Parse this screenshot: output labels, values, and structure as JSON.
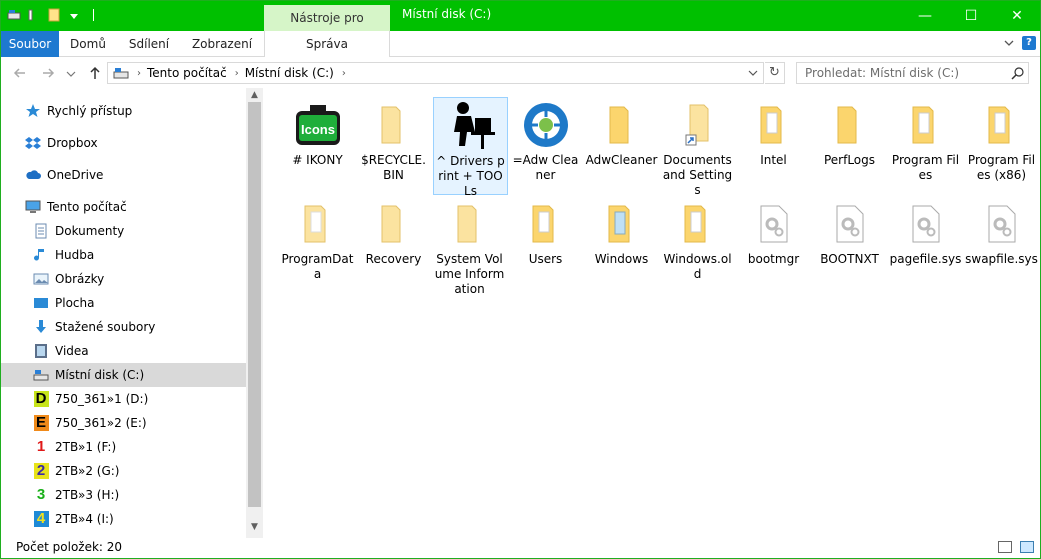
{
  "titlebar": {
    "context_tab": "Nástroje pro jednotky",
    "title": "Místní disk (C:)",
    "minimize": "—",
    "maximize": "☐",
    "close": "✕"
  },
  "ribbon": {
    "tabs": [
      "Soubor",
      "Domů",
      "Sdílení",
      "Zobrazení",
      "Správa"
    ],
    "help": "?"
  },
  "address": {
    "crumbs": [
      "Tento počítač",
      "Místní disk (C:)"
    ],
    "search_placeholder": "Prohledat: Místní disk (C:)"
  },
  "sidebar": {
    "items": [
      {
        "label": "Rychlý přístup",
        "icon": "star-icon"
      },
      {
        "label": "Dropbox",
        "icon": "dropbox-icon"
      },
      {
        "label": "OneDrive",
        "icon": "cloud-icon"
      },
      {
        "label": "Tento počítač",
        "icon": "computer-icon"
      },
      {
        "label": "Dokumenty",
        "icon": "document-icon"
      },
      {
        "label": "Hudba",
        "icon": "music-icon"
      },
      {
        "label": "Obrázky",
        "icon": "pictures-icon"
      },
      {
        "label": "Plocha",
        "icon": "desktop-icon"
      },
      {
        "label": "Stažené soubory",
        "icon": "download-icon"
      },
      {
        "label": "Videa",
        "icon": "video-icon"
      },
      {
        "label": "Místní disk (C:)",
        "icon": "drive-icon"
      },
      {
        "label": "750_361»1 (D:)",
        "icon": "drive-d-icon",
        "letter": "D"
      },
      {
        "label": "750_361»2 (E:)",
        "icon": "drive-e-icon",
        "letter": "E"
      },
      {
        "label": "2TB»1 (F:)",
        "icon": "drive-f-icon",
        "letter": "1"
      },
      {
        "label": "2TB»2 (G:)",
        "icon": "drive-g-icon",
        "letter": "2"
      },
      {
        "label": "2TB»3 (H:)",
        "icon": "drive-h-icon",
        "letter": "3"
      },
      {
        "label": "2TB»4 (I:)",
        "icon": "drive-i-icon",
        "letter": "4"
      }
    ]
  },
  "content": {
    "items": [
      {
        "label": "# IKONY",
        "type": "icons-folder",
        "icon_text": "Icons"
      },
      {
        "label": "$RECYCLE.BIN",
        "type": "folder"
      },
      {
        "label": "^ Drivers print + TOOLs",
        "type": "person-folder"
      },
      {
        "label": "=Adw Cleaner",
        "type": "adw"
      },
      {
        "label": "AdwCleaner",
        "type": "folder"
      },
      {
        "label": "Documents and Settings",
        "type": "folder-link"
      },
      {
        "label": "Intel",
        "type": "folder-docs"
      },
      {
        "label": "PerfLogs",
        "type": "folder"
      },
      {
        "label": "Program Files",
        "type": "folder-docs"
      },
      {
        "label": "Program Files (x86)",
        "type": "folder-docs"
      },
      {
        "label": "ProgramData",
        "type": "folder-docs"
      },
      {
        "label": "Recovery",
        "type": "folder"
      },
      {
        "label": "System Volume Information",
        "type": "folder"
      },
      {
        "label": "Users",
        "type": "folder-docs"
      },
      {
        "label": "Windows",
        "type": "folder-windows"
      },
      {
        "label": "Windows.old",
        "type": "folder-docs"
      },
      {
        "label": "bootmgr",
        "type": "sysfile"
      },
      {
        "label": "BOOTNXT",
        "type": "sysfile"
      },
      {
        "label": "pagefile.sys",
        "type": "sysfile"
      },
      {
        "label": "swapfile.sys",
        "type": "sysfile"
      }
    ]
  },
  "status": {
    "count": "Počet položek: 20"
  },
  "colors": {
    "title_bar": "#00c000",
    "file_tab": "#1e79d0",
    "selection": "#d9d9d9"
  }
}
